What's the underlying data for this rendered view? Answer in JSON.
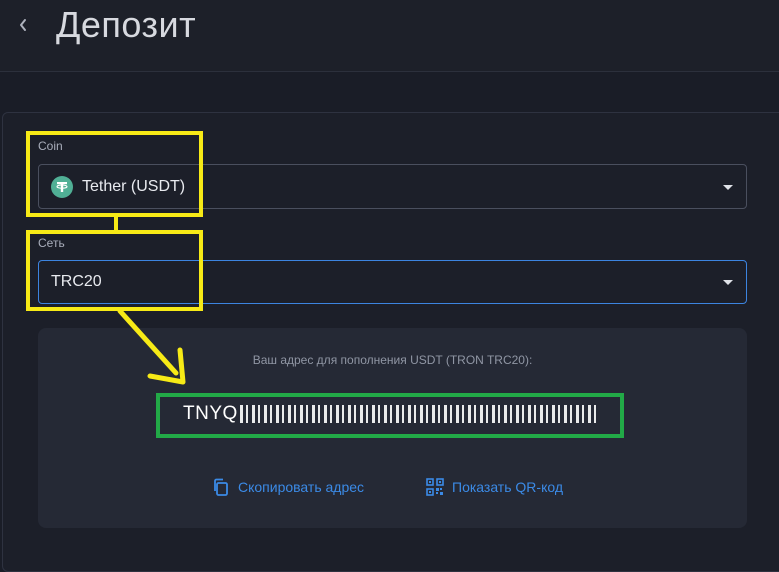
{
  "header": {
    "title": "Депозит",
    "back_icon": "chevron-left-icon"
  },
  "form": {
    "coin": {
      "label": "Coin",
      "selected": "Tether (USDT)",
      "icon": "tether-icon",
      "icon_color": "#50af95"
    },
    "network": {
      "label": "Сеть",
      "selected": "TRC20",
      "focus_color": "#3c84e0"
    }
  },
  "deposit": {
    "caption": "Ваш адрес для пополнения USDT (TRON TRC20):",
    "address_visible": "TNYQ",
    "actions": {
      "copy": {
        "label": "Скопировать адрес",
        "icon": "copy-icon"
      },
      "qr": {
        "label": "Показать QR-код",
        "icon": "qr-code-icon"
      }
    }
  },
  "colors": {
    "accent": "#3b8ae6",
    "highlight_yellow": "#f7ea16",
    "highlight_green": "#22a947"
  }
}
